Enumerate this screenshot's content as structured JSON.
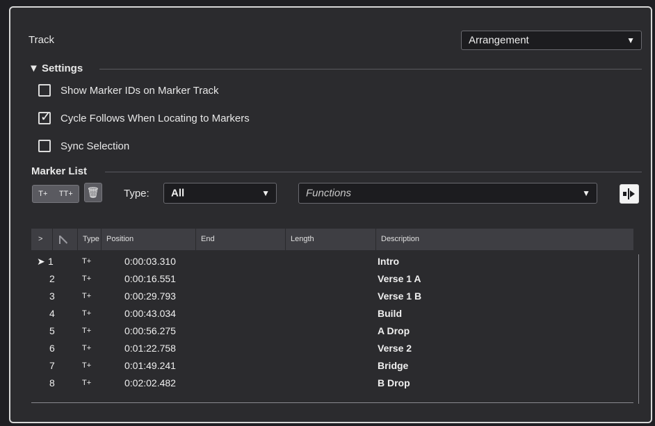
{
  "track": {
    "label": "Track",
    "selected": "Arrangement"
  },
  "settings": {
    "header": "▼ Settings",
    "options": [
      {
        "label": "Show Marker IDs on Marker Track",
        "checked": false
      },
      {
        "label": "Cycle Follows When Locating to Markers",
        "checked": true
      },
      {
        "label": "Sync Selection",
        "checked": false
      }
    ]
  },
  "marker_list": {
    "header": "Marker List",
    "insert_icon_label": "T+",
    "insert_cycle_icon_label": "TT+",
    "type_label": "Type:",
    "type_value": "All",
    "functions_placeholder": "Functions"
  },
  "table": {
    "columns": {
      "expand": ">",
      "id": "",
      "type": "Type",
      "position": "Position",
      "end": "End",
      "length": "Length",
      "description": "Description"
    },
    "rows": [
      {
        "active": "➤",
        "id": "1",
        "type": "T+",
        "position": "0:00:03.310",
        "end": "",
        "length": "",
        "description": "Intro"
      },
      {
        "active": "",
        "id": "2",
        "type": "T+",
        "position": "0:00:16.551",
        "end": "",
        "length": "",
        "description": "Verse 1 A"
      },
      {
        "active": "",
        "id": "3",
        "type": "T+",
        "position": "0:00:29.793",
        "end": "",
        "length": "",
        "description": "Verse 1 B"
      },
      {
        "active": "",
        "id": "4",
        "type": "T+",
        "position": "0:00:43.034",
        "end": "",
        "length": "",
        "description": "Build"
      },
      {
        "active": "",
        "id": "5",
        "type": "T+",
        "position": "0:00:56.275",
        "end": "",
        "length": "",
        "description": "A Drop"
      },
      {
        "active": "",
        "id": "6",
        "type": "T+",
        "position": "0:01:22.758",
        "end": "",
        "length": "",
        "description": "Verse 2"
      },
      {
        "active": "",
        "id": "7",
        "type": "T+",
        "position": "0:01:49.241",
        "end": "",
        "length": "",
        "description": "Bridge"
      },
      {
        "active": "",
        "id": "8",
        "type": "T+",
        "position": "0:02:02.482",
        "end": "",
        "length": "",
        "description": "B Drop"
      }
    ]
  }
}
